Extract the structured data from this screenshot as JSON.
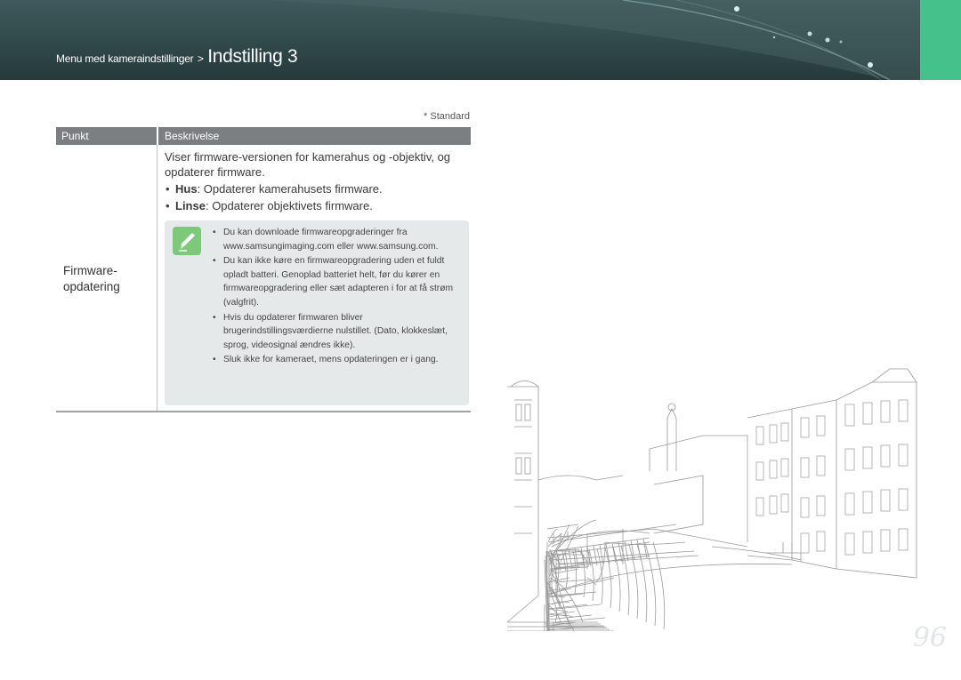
{
  "header": {
    "breadcrumb_parent": "Menu med kameraindstillinger",
    "breadcrumb_sep": ">",
    "breadcrumb_current": "Indstilling 3",
    "accent_color": "#45c18c",
    "bg_color": "#2f4749"
  },
  "standard_note": "* Standard",
  "table": {
    "col_item": "Punkt",
    "col_desc": "Beskrivelse",
    "row": {
      "item": "Firmware-\nopdatering",
      "intro": "Viser firmware-versionen for kamerahus og -objektiv, og opdaterer firmware.",
      "bullets": [
        {
          "term": "Hus",
          "text": ": Opdaterer kamerahusets firmware."
        },
        {
          "term": "Linse",
          "text": ": Opdaterer objektivets firmware."
        }
      ],
      "note_icon": "pencil-note-icon",
      "notes": [
        "Du kan downloade firmwareopgraderinger fra www.samsungimaging.com eller www.samsung.com.",
        "Du kan ikke køre en firmwareopgradering uden et fuldt opladt batteri. Genoplad batteriet helt, før du kører en firmwareopgradering eller sæt adapteren i for at få strøm (valgfrit).",
        "Hvis du opdaterer firmwaren bliver brugerindstillingsværdierne nulstillet. (Dato, klokkeslæt, sprog, videosignal ændres ikke).",
        "Sluk ikke for kameraet, mens opdateringen er i gang."
      ]
    }
  },
  "page_number": "96"
}
